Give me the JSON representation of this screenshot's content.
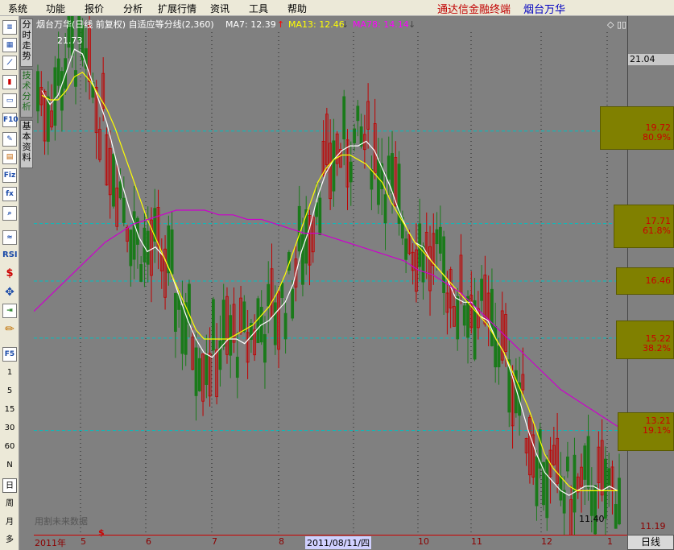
{
  "menu": {
    "items": [
      "系统",
      "功能",
      "报价",
      "分析",
      "扩展行情",
      "资讯",
      "工具",
      "帮助"
    ],
    "brand": "通达信金融终端",
    "stock": "烟台万华"
  },
  "toolbar": {
    "icons": [
      "quote-list-icon",
      "grid-icon",
      "line-chart-icon",
      "candle-icon",
      "window-icon",
      "f10-icon",
      "note-icon",
      "calendar-icon",
      "fiz-icon",
      "formula-icon",
      "zoom-icon"
    ],
    "indicators": [
      "RSI"
    ],
    "tools": [
      "dollar-icon",
      "move-icon",
      "export-icon",
      "pencil-icon"
    ],
    "f5": "F5",
    "periods": [
      "1",
      "5",
      "15",
      "30",
      "60",
      "N",
      "日",
      "周",
      "月",
      "多"
    ]
  },
  "sidetabs": [
    "分时走势",
    "技术分析",
    "基本资料"
  ],
  "chart_header": {
    "title": "烟台万华(日线 前复权) 自适应等分线(2,360)",
    "ma7": "MA7: 12.39",
    "ma13": "MA13: 12.46",
    "ma78": "MA78: 14.14"
  },
  "annotations": {
    "high": "21.73",
    "low": "11.40",
    "watermark": "用割未来数据"
  },
  "price_axis": {
    "top": "21.04",
    "bottom": "11.19"
  },
  "date_axis": {
    "labels": [
      "2011年",
      "5",
      "$",
      "6",
      "7",
      "8",
      "2011/08/11/四",
      "10",
      "11",
      "12",
      "1"
    ],
    "period": "日线"
  },
  "gbox": [
    {
      "price": "19.72",
      "pct": "80.9%"
    },
    {
      "price": "17.71",
      "pct": "61.8%"
    },
    {
      "price": "16.46",
      "pct": ""
    },
    {
      "price": "15.22",
      "pct": "38.2%"
    },
    {
      "price": "13.21",
      "pct": "19.1%"
    }
  ],
  "colors": {
    "bg": "#808080",
    "up": "#c00000",
    "down": "#1a7a1a",
    "ma7": "#ffffff",
    "ma13": "#ffff00",
    "ma78": "#cc00cc",
    "fib": "#00c0c0"
  },
  "chart_data": {
    "type": "candlestick",
    "title": "烟台万华(日线 前复权) 自适应等分线(2,360)",
    "ylim": [
      11.19,
      21.73
    ],
    "fib_levels": [
      19.72,
      17.71,
      16.46,
      15.22,
      13.21
    ],
    "series": [
      {
        "name": "MA7",
        "values": [
          20.6,
          20.3,
          20.5,
          21.0,
          21.5,
          21.4,
          20.9,
          20.4,
          19.9,
          19.2,
          18.5,
          17.9,
          17.4,
          17.1,
          17.2,
          17.0,
          16.6,
          16.1,
          15.6,
          15.2,
          14.9,
          14.8,
          15.0,
          15.2,
          15.2,
          15.1,
          15.3,
          15.5,
          15.6,
          15.8,
          16.0,
          16.4,
          17.1,
          17.6,
          18.3,
          18.8,
          19.1,
          19.3,
          19.4,
          19.4,
          19.5,
          19.3,
          18.9,
          18.5,
          18.0,
          17.6,
          17.3,
          17.2,
          16.9,
          16.7,
          16.5,
          16.1,
          16.0,
          16.0,
          15.7,
          15.6,
          15.2,
          14.9,
          14.4,
          13.8,
          13.2,
          12.7,
          12.3,
          12.1,
          11.9,
          11.8,
          11.9,
          12.0,
          12.0,
          11.9,
          12.0,
          11.9
        ]
      },
      {
        "name": "MA13",
        "values": [
          20.5,
          20.4,
          20.4,
          20.6,
          20.9,
          21.0,
          20.8,
          20.5,
          20.2,
          19.8,
          19.3,
          18.8,
          18.3,
          17.8,
          17.4,
          17.0,
          16.6,
          16.2,
          15.8,
          15.4,
          15.2,
          15.2,
          15.2,
          15.2,
          15.3,
          15.4,
          15.5,
          15.7,
          15.9,
          16.2,
          16.6,
          17.1,
          17.6,
          18.1,
          18.6,
          18.9,
          19.1,
          19.2,
          19.2,
          19.1,
          19.0,
          18.8,
          18.6,
          18.2,
          17.9,
          17.6,
          17.3,
          17.1,
          16.9,
          16.7,
          16.5,
          16.3,
          16.1,
          15.9,
          15.7,
          15.5,
          15.2,
          14.9,
          14.5,
          14.1,
          13.7,
          13.2,
          12.7,
          12.4,
          12.2,
          12.0,
          11.9,
          11.9,
          11.9,
          11.9,
          11.9,
          11.9
        ]
      },
      {
        "name": "MA78",
        "values": [
          15.8,
          16.1,
          16.4,
          16.7,
          17.0,
          17.3,
          17.5,
          17.7,
          17.8,
          17.9,
          18.0,
          18.0,
          18.0,
          17.9,
          17.9,
          17.8,
          17.8,
          17.7,
          17.6,
          17.5,
          17.5,
          17.4,
          17.3,
          17.2,
          17.1,
          17.0,
          16.9,
          16.7,
          16.6,
          16.4,
          16.2,
          15.9,
          15.6,
          15.3,
          15.0,
          14.7,
          14.4,
          14.1,
          13.9,
          13.7,
          13.5,
          13.3
        ]
      }
    ],
    "xlabels": [
      "2011年",
      "5",
      "6",
      "7",
      "8",
      "2011/08/11/四",
      "10",
      "11",
      "12",
      "1"
    ]
  }
}
